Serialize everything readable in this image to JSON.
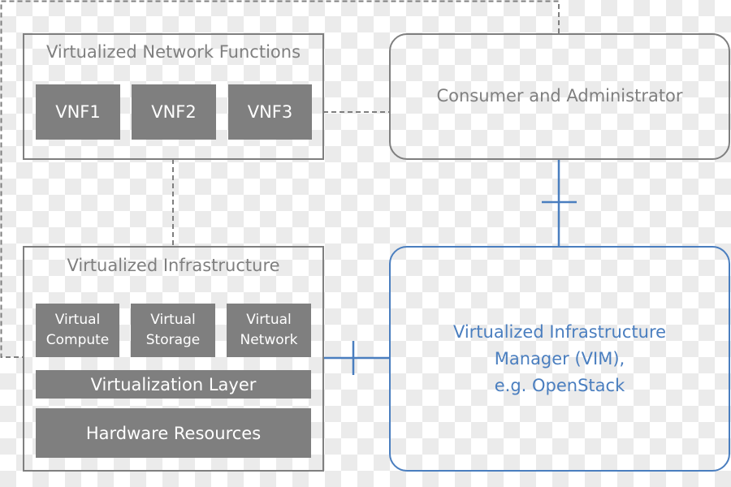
{
  "vnf_group": {
    "title": "Virtualized Network Functions",
    "items": [
      "VNF1",
      "VNF2",
      "VNF3"
    ]
  },
  "consumer": {
    "label": "Consumer and Administrator"
  },
  "infrastructure": {
    "title": "Virtualized Infrastructure",
    "resources": [
      {
        "line1": "Virtual",
        "line2": "Compute"
      },
      {
        "line1": "Virtual",
        "line2": "Storage"
      },
      {
        "line1": "Virtual",
        "line2": "Network"
      }
    ],
    "virtualization_layer": "Virtualization Layer",
    "hardware": "Hardware Resources"
  },
  "vim": {
    "line1": "Virtualized Infrastructure",
    "line2": "Manager (VIM),",
    "line3": "e.g. OpenStack"
  },
  "colors": {
    "gray": "#7f7f7f",
    "blue": "#4a7ebf"
  }
}
